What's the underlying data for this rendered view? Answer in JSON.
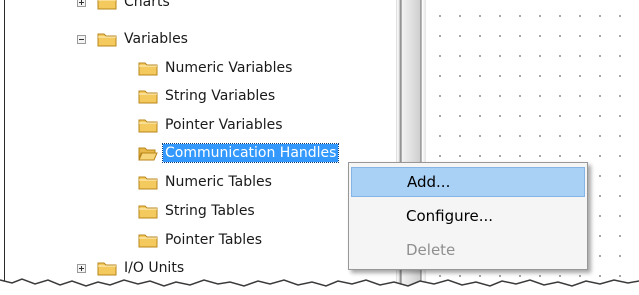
{
  "tree": {
    "items": [
      {
        "label": "Charts",
        "expander": "plus",
        "indent": 0
      },
      {
        "label": "Variables",
        "expander": "minus",
        "indent": 0
      },
      {
        "label": "Numeric Variables",
        "indent": 1
      },
      {
        "label": "String Variables",
        "indent": 1
      },
      {
        "label": "Pointer Variables",
        "indent": 1
      },
      {
        "label": "Communication Handles",
        "indent": 1,
        "selected": true
      },
      {
        "label": "Numeric Tables",
        "indent": 1
      },
      {
        "label": "String Tables",
        "indent": 1
      },
      {
        "label": "Pointer Tables",
        "indent": 1
      },
      {
        "label": "I/O Units",
        "expander": "plus",
        "indent": 0
      }
    ]
  },
  "context_menu": {
    "items": [
      {
        "label": "Add...",
        "highlighted": true,
        "enabled": true
      },
      {
        "label": "Configure...",
        "highlighted": false,
        "enabled": true
      },
      {
        "label": "Delete",
        "highlighted": false,
        "enabled": false
      }
    ]
  },
  "colors": {
    "selection": "#3399ff",
    "menu_highlight": "#a9d1f5",
    "folder": "#f4c95d"
  }
}
